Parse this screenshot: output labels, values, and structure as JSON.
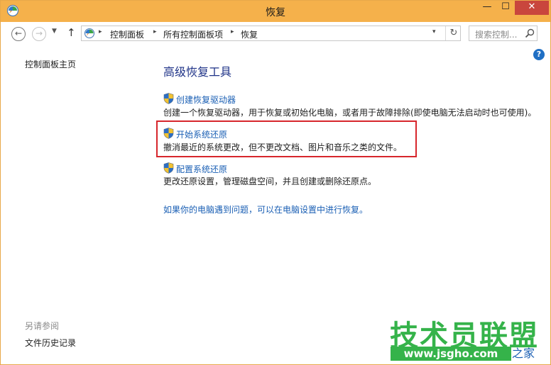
{
  "window": {
    "title": "恢复",
    "min_glyph": "—",
    "max_glyph": "☐",
    "close_glyph": "✕",
    "accent": "#f5b14b"
  },
  "nav": {
    "back_glyph": "←",
    "forward_glyph": "→",
    "recent_glyph": "▼",
    "up_glyph": "↑",
    "breadcrumbs": [
      "控制面板",
      "所有控制面板项",
      "恢复"
    ],
    "separator_glyph": "▸",
    "dropdown_glyph": "▾",
    "refresh_glyph": "↻",
    "search_placeholder": "搜索控制..."
  },
  "help": {
    "glyph": "?"
  },
  "sidebar": {
    "home": "控制面板主页",
    "see_also": "另请参阅",
    "file_history": "文件历史记录"
  },
  "main": {
    "title": "高级恢复工具",
    "items": [
      {
        "link": "创建恢复驱动器",
        "desc": "创建一个恢复驱动器，用于恢复或初始化电脑，或者用于故障排除(即使电脑无法启动时也可使用)。"
      },
      {
        "link": "开始系统还原",
        "desc": "撤消最近的系统更改，但不更改文档、图片和音乐之类的文件。"
      },
      {
        "link": "配置系统还原",
        "desc": "更改还原设置，管理磁盘空间，并且创建或删除还原点。"
      }
    ],
    "footer_link": "如果你的电脑遇到问题，可以在电脑设置中进行恢复。"
  },
  "watermark": {
    "main": "技术员联盟",
    "url": "www.jsgho.com",
    "tail": "之家"
  },
  "colors": {
    "link": "#1a5fb4",
    "highlight_box": "#d7262c",
    "watermark": "#35b34a"
  }
}
